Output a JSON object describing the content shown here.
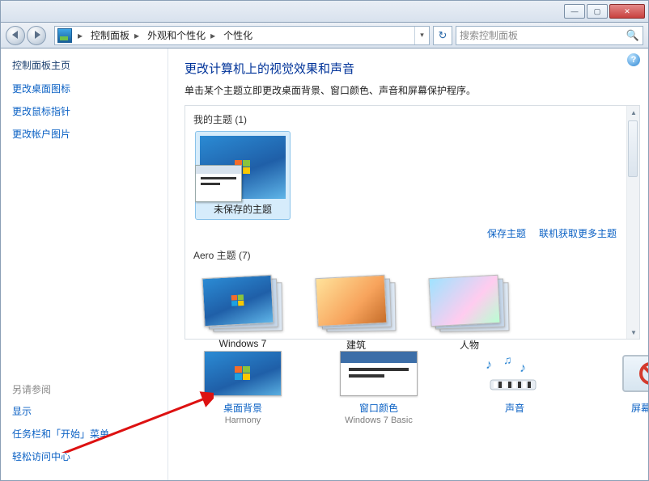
{
  "titlebar": {
    "min": "—",
    "max": "▢",
    "close": "✕"
  },
  "breadcrumb": {
    "root": "控制面板",
    "lvl2": "外观和个性化",
    "lvl3": "个性化"
  },
  "search": {
    "placeholder": "搜索控制面板"
  },
  "sidebar": {
    "heading": "控制面板主页",
    "links": [
      "更改桌面图标",
      "更改鼠标指针",
      "更改帐户图片"
    ],
    "seealso_heading": "另请参阅",
    "seealso": [
      "显示",
      "任务栏和「开始」菜单",
      "轻松访问中心"
    ]
  },
  "page": {
    "title": "更改计算机上的视觉效果和声音",
    "subtitle": "单击某个主题立即更改桌面背景、窗口颜色、声音和屏幕保护程序。"
  },
  "themes": {
    "group1_label": "我的主题 (1)",
    "unsaved_name": "未保存的主题",
    "link_save": "保存主题",
    "link_more": "联机获取更多主题",
    "group2_label": "Aero 主题 (7)",
    "aero": [
      "Windows 7",
      "建筑",
      "人物"
    ]
  },
  "settings": {
    "tiles": [
      {
        "label": "桌面背景",
        "sub": "Harmony"
      },
      {
        "label": "窗口颜色",
        "sub": "Windows 7 Basic"
      },
      {
        "label": "声音",
        "sub": ""
      },
      {
        "label": "屏幕保护",
        "sub": ""
      }
    ]
  }
}
